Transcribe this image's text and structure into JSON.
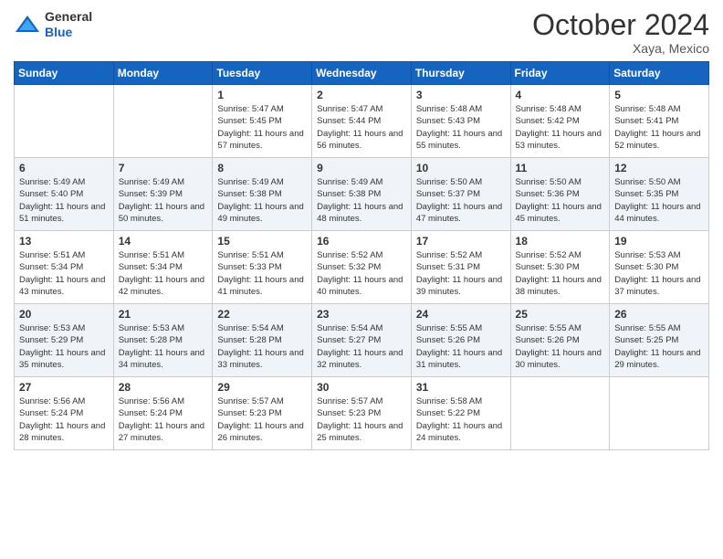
{
  "logo": {
    "general": "General",
    "blue": "Blue"
  },
  "title": "October 2024",
  "location": "Xaya, Mexico",
  "days_of_week": [
    "Sunday",
    "Monday",
    "Tuesday",
    "Wednesday",
    "Thursday",
    "Friday",
    "Saturday"
  ],
  "weeks": [
    [
      {
        "day": "",
        "info": ""
      },
      {
        "day": "",
        "info": ""
      },
      {
        "day": "1",
        "info": "Sunrise: 5:47 AM\nSunset: 5:45 PM\nDaylight: 11 hours and 57 minutes."
      },
      {
        "day": "2",
        "info": "Sunrise: 5:47 AM\nSunset: 5:44 PM\nDaylight: 11 hours and 56 minutes."
      },
      {
        "day": "3",
        "info": "Sunrise: 5:48 AM\nSunset: 5:43 PM\nDaylight: 11 hours and 55 minutes."
      },
      {
        "day": "4",
        "info": "Sunrise: 5:48 AM\nSunset: 5:42 PM\nDaylight: 11 hours and 53 minutes."
      },
      {
        "day": "5",
        "info": "Sunrise: 5:48 AM\nSunset: 5:41 PM\nDaylight: 11 hours and 52 minutes."
      }
    ],
    [
      {
        "day": "6",
        "info": "Sunrise: 5:49 AM\nSunset: 5:40 PM\nDaylight: 11 hours and 51 minutes."
      },
      {
        "day": "7",
        "info": "Sunrise: 5:49 AM\nSunset: 5:39 PM\nDaylight: 11 hours and 50 minutes."
      },
      {
        "day": "8",
        "info": "Sunrise: 5:49 AM\nSunset: 5:38 PM\nDaylight: 11 hours and 49 minutes."
      },
      {
        "day": "9",
        "info": "Sunrise: 5:49 AM\nSunset: 5:38 PM\nDaylight: 11 hours and 48 minutes."
      },
      {
        "day": "10",
        "info": "Sunrise: 5:50 AM\nSunset: 5:37 PM\nDaylight: 11 hours and 47 minutes."
      },
      {
        "day": "11",
        "info": "Sunrise: 5:50 AM\nSunset: 5:36 PM\nDaylight: 11 hours and 45 minutes."
      },
      {
        "day": "12",
        "info": "Sunrise: 5:50 AM\nSunset: 5:35 PM\nDaylight: 11 hours and 44 minutes."
      }
    ],
    [
      {
        "day": "13",
        "info": "Sunrise: 5:51 AM\nSunset: 5:34 PM\nDaylight: 11 hours and 43 minutes."
      },
      {
        "day": "14",
        "info": "Sunrise: 5:51 AM\nSunset: 5:34 PM\nDaylight: 11 hours and 42 minutes."
      },
      {
        "day": "15",
        "info": "Sunrise: 5:51 AM\nSunset: 5:33 PM\nDaylight: 11 hours and 41 minutes."
      },
      {
        "day": "16",
        "info": "Sunrise: 5:52 AM\nSunset: 5:32 PM\nDaylight: 11 hours and 40 minutes."
      },
      {
        "day": "17",
        "info": "Sunrise: 5:52 AM\nSunset: 5:31 PM\nDaylight: 11 hours and 39 minutes."
      },
      {
        "day": "18",
        "info": "Sunrise: 5:52 AM\nSunset: 5:30 PM\nDaylight: 11 hours and 38 minutes."
      },
      {
        "day": "19",
        "info": "Sunrise: 5:53 AM\nSunset: 5:30 PM\nDaylight: 11 hours and 37 minutes."
      }
    ],
    [
      {
        "day": "20",
        "info": "Sunrise: 5:53 AM\nSunset: 5:29 PM\nDaylight: 11 hours and 35 minutes."
      },
      {
        "day": "21",
        "info": "Sunrise: 5:53 AM\nSunset: 5:28 PM\nDaylight: 11 hours and 34 minutes."
      },
      {
        "day": "22",
        "info": "Sunrise: 5:54 AM\nSunset: 5:28 PM\nDaylight: 11 hours and 33 minutes."
      },
      {
        "day": "23",
        "info": "Sunrise: 5:54 AM\nSunset: 5:27 PM\nDaylight: 11 hours and 32 minutes."
      },
      {
        "day": "24",
        "info": "Sunrise: 5:55 AM\nSunset: 5:26 PM\nDaylight: 11 hours and 31 minutes."
      },
      {
        "day": "25",
        "info": "Sunrise: 5:55 AM\nSunset: 5:26 PM\nDaylight: 11 hours and 30 minutes."
      },
      {
        "day": "26",
        "info": "Sunrise: 5:55 AM\nSunset: 5:25 PM\nDaylight: 11 hours and 29 minutes."
      }
    ],
    [
      {
        "day": "27",
        "info": "Sunrise: 5:56 AM\nSunset: 5:24 PM\nDaylight: 11 hours and 28 minutes."
      },
      {
        "day": "28",
        "info": "Sunrise: 5:56 AM\nSunset: 5:24 PM\nDaylight: 11 hours and 27 minutes."
      },
      {
        "day": "29",
        "info": "Sunrise: 5:57 AM\nSunset: 5:23 PM\nDaylight: 11 hours and 26 minutes."
      },
      {
        "day": "30",
        "info": "Sunrise: 5:57 AM\nSunset: 5:23 PM\nDaylight: 11 hours and 25 minutes."
      },
      {
        "day": "31",
        "info": "Sunrise: 5:58 AM\nSunset: 5:22 PM\nDaylight: 11 hours and 24 minutes."
      },
      {
        "day": "",
        "info": ""
      },
      {
        "day": "",
        "info": ""
      }
    ]
  ]
}
